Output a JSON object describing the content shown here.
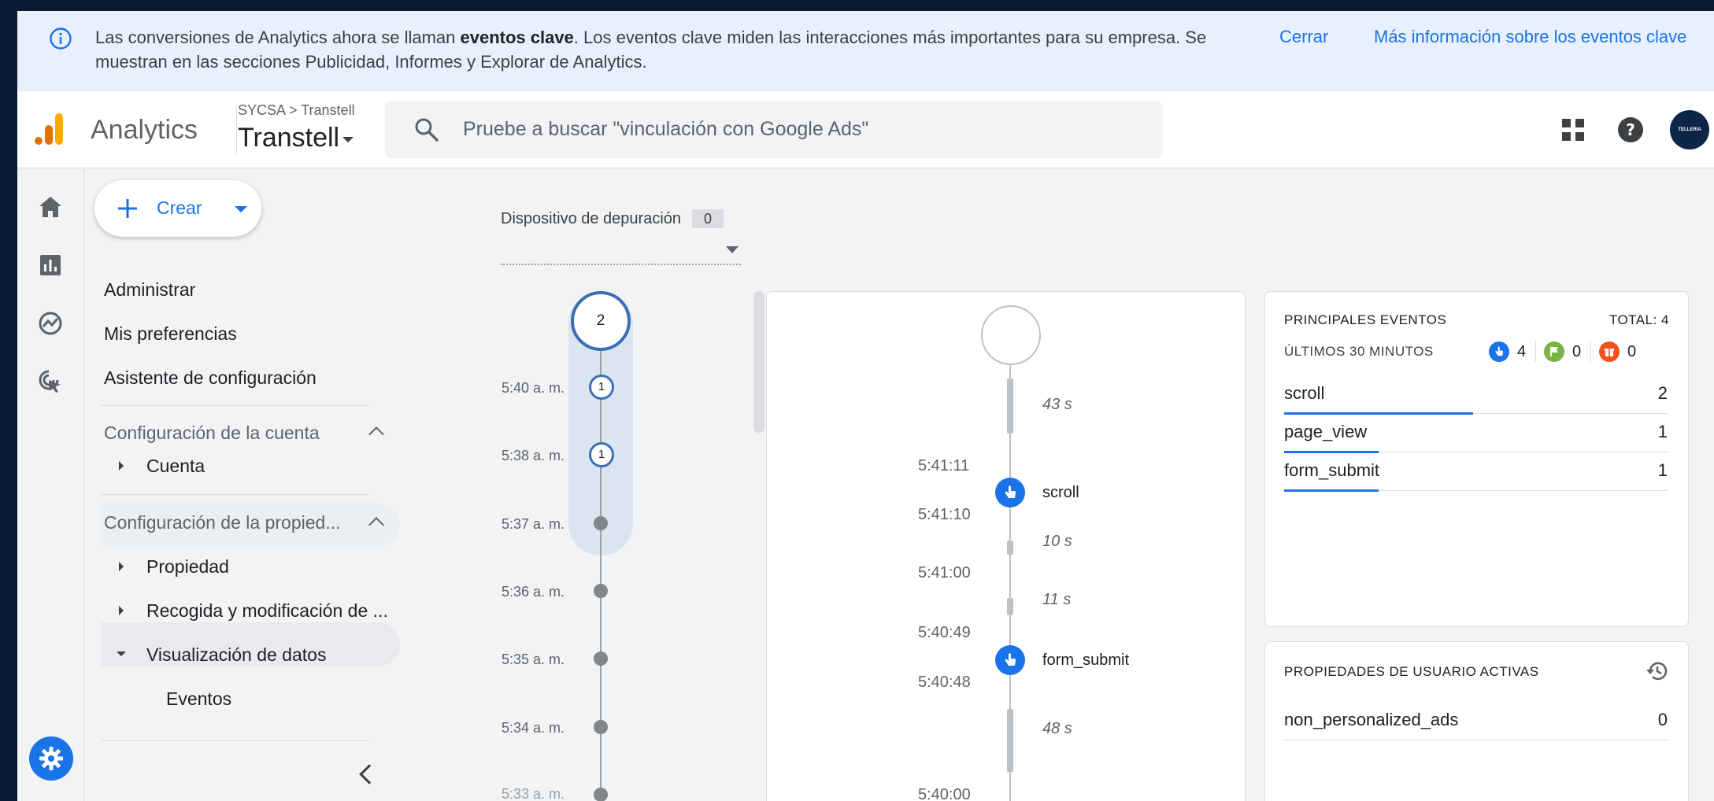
{
  "banner": {
    "text_before": "Las conversiones de Analytics ahora se llaman ",
    "text_bold": "eventos clave",
    "text_after": ". Los eventos clave miden las interacciones más importantes para su empresa. Se muestran en las secciones Publicidad, Informes y Explorar de Analytics.",
    "close_label": "Cerrar",
    "more_label": "Más información sobre los eventos clave"
  },
  "header": {
    "product": "Analytics",
    "breadcrumb": "SYCSA > Transtell",
    "property": "Transtell",
    "search_placeholder": "Pruebe a buscar \"vinculación con Google Ads\"",
    "avatar_text": "TELLERIA"
  },
  "nav": {
    "create_label": "Crear",
    "items": [
      "Administrar",
      "Mis preferencias",
      "Asistente de configuración"
    ],
    "account_section": "Configuración de la cuenta",
    "account_children": [
      "Cuenta"
    ],
    "property_section": "Configuración de la propied...",
    "property_children": [
      "Propiedad",
      "Recogida y modificación de ...",
      "Visualización de datos"
    ],
    "data_display_children": [
      "Eventos"
    ]
  },
  "debug": {
    "device_label": "Dispositivo de depuración",
    "device_count": "0",
    "current_count": "2",
    "minutes": [
      {
        "time": "5:40 a. m.",
        "count": "1"
      },
      {
        "time": "5:38 a. m.",
        "count": "1"
      },
      {
        "time": "5:37 a. m.",
        "count": ""
      },
      {
        "time": "5:36 a. m.",
        "count": ""
      },
      {
        "time": "5:35 a. m.",
        "count": ""
      },
      {
        "time": "5:34 a. m.",
        "count": ""
      },
      {
        "time": "5:33 a. m.",
        "count": ""
      }
    ],
    "seconds": {
      "gaps": [
        "43 s",
        "10 s",
        "11 s",
        "48 s"
      ],
      "times": [
        "5:41:11",
        "5:41:10",
        "5:41:00",
        "5:40:49",
        "5:40:48",
        "5:40:00"
      ],
      "events": [
        "scroll",
        "form_submit"
      ]
    }
  },
  "top_events": {
    "title": "PRINCIPALES EVENTOS",
    "total": "TOTAL: 4",
    "subtitle": "ÚLTIMOS 30 MINUTOS",
    "counts": {
      "events": "4",
      "key_events": "0",
      "conversions": "0"
    },
    "colors": {
      "events": "#1a73e8",
      "key_events": "#7cb342",
      "conversions": "#f4511e"
    },
    "rows": [
      {
        "name": "scroll",
        "value": "2",
        "fraction": 1.0
      },
      {
        "name": "page_view",
        "value": "1",
        "fraction": 0.5
      },
      {
        "name": "form_submit",
        "value": "1",
        "fraction": 0.5
      }
    ]
  },
  "user_props": {
    "title": "PROPIEDADES DE USUARIO ACTIVAS",
    "rows": [
      {
        "name": "non_personalized_ads",
        "value": "0"
      }
    ]
  }
}
